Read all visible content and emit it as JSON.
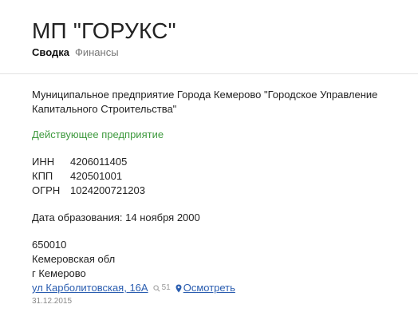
{
  "header": {
    "title": "МП \"ГОРУКС\"",
    "tabs": [
      {
        "label": "Сводка",
        "active": true
      },
      {
        "label": "Финансы",
        "active": false
      }
    ]
  },
  "company": {
    "full_name": "Муниципальное предприятие Города Кемерово \"Городское Управление Капитального Строительства\"",
    "status": "Действующее предприятие",
    "codes": [
      {
        "label": "ИНН",
        "value": "4206011405"
      },
      {
        "label": "КПП",
        "value": "420501001"
      },
      {
        "label": "ОГРН",
        "value": "1024200721203"
      }
    ],
    "founded": "Дата образования: 14 ноября 2000"
  },
  "address": {
    "postal_code": "650010",
    "region": "Кемеровская обл",
    "city": "г Кемерово",
    "street": "ул Карболитовская, 16А",
    "count": "51",
    "map_label": "Осмотреть",
    "date": "31.12.2015"
  },
  "colors": {
    "status_green": "#3e9a3e",
    "link_blue": "#2a5db0"
  },
  "icons": {
    "count": "search-icon",
    "map": "map-pin-icon"
  }
}
